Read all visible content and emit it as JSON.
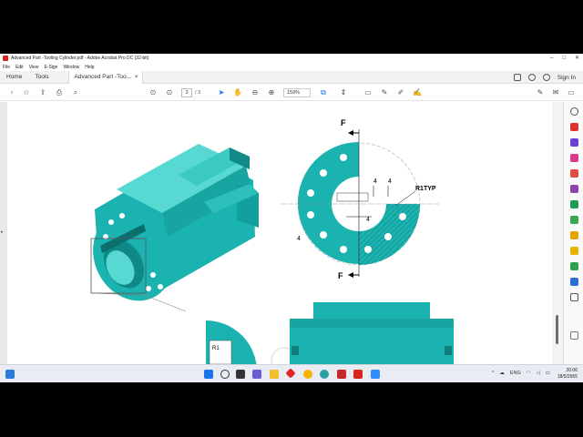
{
  "window": {
    "title": "Advanced Part -Tooling Cylinder.pdf - Adobe Acrobat Pro DC (32-bit)",
    "minimize": "–",
    "maximize": "□",
    "close": "✕"
  },
  "menu": [
    "File",
    "Edit",
    "View",
    "E-Sign",
    "Window",
    "Help"
  ],
  "tabs": {
    "home": "Home",
    "tools": "Tools",
    "document": "Advanced Part -Too...",
    "close": "×",
    "signin": "Sign In"
  },
  "toolbar": {
    "page_current": "3",
    "page_total": "/ 3",
    "zoom": "159%"
  },
  "drawing": {
    "label_f_top": "F",
    "label_f_bottom": "F",
    "label_r1typ": "R1TYP",
    "dim_4a": "4",
    "dim_4b": "4",
    "dim_4c": "4",
    "dim_4d": "4",
    "label_r1": "R1",
    "colors": {
      "part": "#1bb3b0",
      "part_dark": "#118a88",
      "part_light": "#57d8d3",
      "hatch": "#0e7f7d"
    }
  },
  "taskbar": {
    "lang": "ENG",
    "time": "20:06",
    "date": "18/5/2565"
  }
}
